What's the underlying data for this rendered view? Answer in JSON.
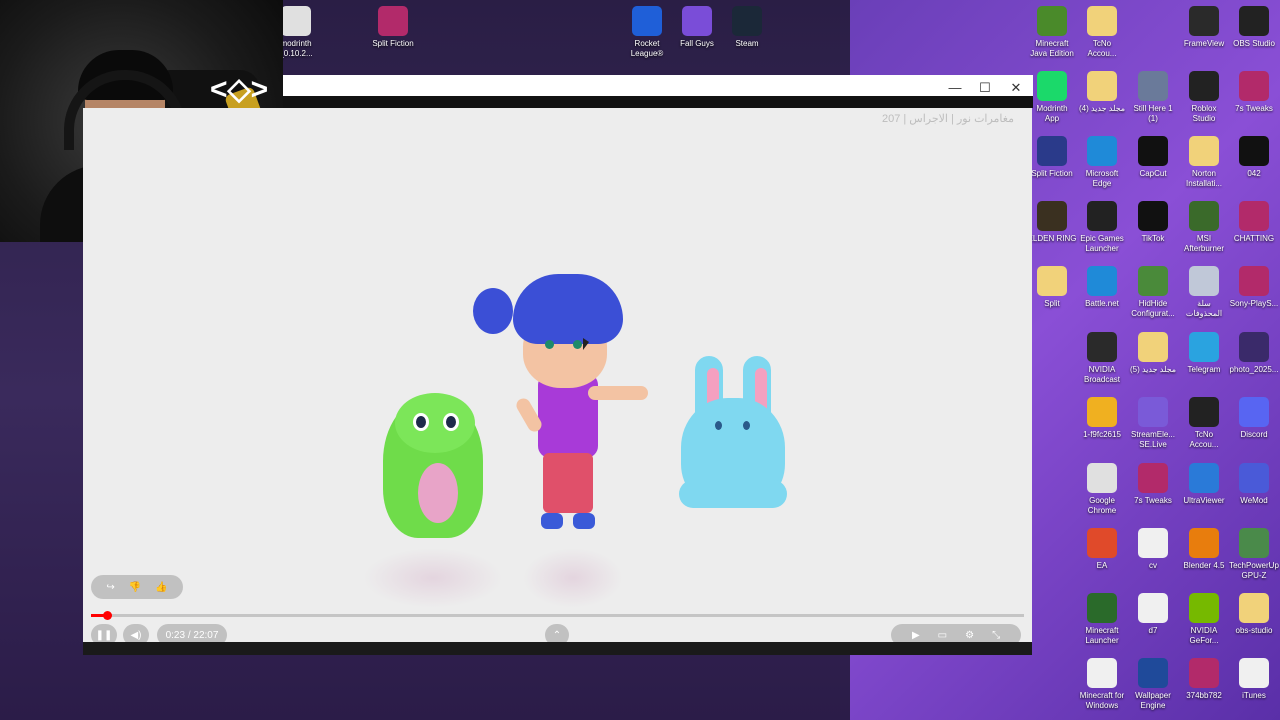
{
  "desktop": {
    "top_icons": [
      {
        "label": "modrinth\n_0.10.2...",
        "icon": "modrinth-installer-icon",
        "color": "#e0e0e0"
      },
      {
        "label": "Split Fiction",
        "icon": "winrar-icon",
        "color": "#b22a6a"
      },
      {
        "label": "Rocket\nLeague®",
        "icon": "rocket-league-icon",
        "color": "#1f5fd8"
      },
      {
        "label": "Fall Guys",
        "icon": "fall-guys-icon",
        "color": "#7a4dd8"
      },
      {
        "label": "Steam",
        "icon": "steam-icon",
        "color": "#1b2838"
      }
    ],
    "right_icons": [
      {
        "label": "Minecraft\nJava Edition",
        "icon": "minecraft-icon",
        "color": "#4a8a2a"
      },
      {
        "label": "TcNo\nAccou...",
        "icon": "folder-icon",
        "color": "#f1d27a"
      },
      {
        "label": "FrameView",
        "icon": "frameview-icon",
        "color": "#2a2a2a"
      },
      {
        "label": "OBS Studio",
        "icon": "obs-icon",
        "color": "#222222"
      },
      {
        "label": "Modrinth\nApp",
        "icon": "modrinth-icon",
        "color": "#1bd96a"
      },
      {
        "label": "مجلد جديد (4)",
        "icon": "folder-icon",
        "color": "#f1d27a"
      },
      {
        "label": "Still Here 1\n(1)",
        "icon": "image-icon",
        "color": "#6a7a9a"
      },
      {
        "label": "Roblox\nStudio",
        "icon": "roblox-studio-icon",
        "color": "#222222"
      },
      {
        "label": "7s Tweaks",
        "icon": "winrar-icon",
        "color": "#b22a6a"
      },
      {
        "label": "Split Fiction",
        "icon": "split-fiction-icon",
        "color": "#2a3a8a"
      },
      {
        "label": "Microsoft\nEdge",
        "icon": "edge-icon",
        "color": "#1f8ad8"
      },
      {
        "label": "CapCut",
        "icon": "capcut-icon",
        "color": "#111111"
      },
      {
        "label": "Norton\nInstallati...",
        "icon": "folder-icon",
        "color": "#f1d27a"
      },
      {
        "label": "042",
        "icon": "image-icon",
        "color": "#111111"
      },
      {
        "label": "ELDEN RING",
        "icon": "elden-ring-icon",
        "color": "#3a3020"
      },
      {
        "label": "Epic Games\nLauncher",
        "icon": "epic-games-icon",
        "color": "#222222"
      },
      {
        "label": "TikTok",
        "icon": "tiktok-icon",
        "color": "#111111"
      },
      {
        "label": "MSI\nAfterburner",
        "icon": "msi-afterburner-icon",
        "color": "#3a6a2a"
      },
      {
        "label": "CHATTING",
        "icon": "winrar-icon",
        "color": "#b22a6a"
      },
      {
        "label": "Split",
        "icon": "folder-icon",
        "color": "#f1d27a"
      },
      {
        "label": "Battle.net",
        "icon": "battlenet-icon",
        "color": "#1f8ad8"
      },
      {
        "label": "HidHide\nConfigurat...",
        "icon": "hidhide-icon",
        "color": "#4a8a3a"
      },
      {
        "label": "سلة\nالمحذوفات",
        "icon": "recycle-bin-icon",
        "color": "#c0c8d8"
      },
      {
        "label": "Sony-PlayS...",
        "icon": "winrar-icon",
        "color": "#b22a6a"
      },
      {
        "label": "NVIDIA\nBroadcast",
        "icon": "nvidia-broadcast-icon",
        "color": "#2a2a2a"
      },
      {
        "label": "مجلد جديد (5)",
        "icon": "folder-icon",
        "color": "#f1d27a"
      },
      {
        "label": "Telegram",
        "icon": "telegram-icon",
        "color": "#2aa3e0"
      },
      {
        "label": "photo_2025...",
        "icon": "image-icon",
        "color": "#3a2a6a"
      },
      {
        "label": "1-f9fc2615",
        "icon": "emoji-icon",
        "color": "#f0b020"
      },
      {
        "label": "StreamEle...\nSE.Live",
        "icon": "streamelements-icon",
        "color": "#7a5ad8"
      },
      {
        "label": "TcNo\nAccou...",
        "icon": "tcno-icon",
        "color": "#222222"
      },
      {
        "label": "Discord",
        "icon": "discord-icon",
        "color": "#5865f2"
      },
      {
        "label": "Google\nChrome",
        "icon": "chrome-icon",
        "color": "#e0e0e0"
      },
      {
        "label": "7s Tweaks",
        "icon": "winrar-icon",
        "color": "#b22a6a"
      },
      {
        "label": "UltraViewer",
        "icon": "ultraviewer-icon",
        "color": "#2a7ad8"
      },
      {
        "label": "WeMod",
        "icon": "wemod-icon",
        "color": "#4a5ad8"
      },
      {
        "label": "EA",
        "icon": "ea-icon",
        "color": "#e04a2a"
      },
      {
        "label": "cv",
        "icon": "document-icon",
        "color": "#f0f0f0"
      },
      {
        "label": "Blender 4.5",
        "icon": "blender-icon",
        "color": "#e87d0d"
      },
      {
        "label": "TechPowerUp\nGPU-Z",
        "icon": "gpuz-icon",
        "color": "#4a8a4a"
      },
      {
        "label": "Minecraft\nLauncher",
        "icon": "minecraft-launcher-icon",
        "color": "#2a6a2a"
      },
      {
        "label": "d7",
        "icon": "document-icon",
        "color": "#f0f0f0"
      },
      {
        "label": "NVIDIA\nGeFor...",
        "icon": "nvidia-icon",
        "color": "#76b900"
      },
      {
        "label": "obs-studio",
        "icon": "folder-icon",
        "color": "#f1d27a"
      },
      {
        "label": "Minecraft for\nWindows",
        "icon": "document-icon",
        "color": "#f0f0f0"
      },
      {
        "label": "Wallpaper\nEngine",
        "icon": "wallpaper-engine-icon",
        "color": "#1f4a9a"
      },
      {
        "label": "374bb782",
        "icon": "winrar-icon",
        "color": "#b22a6a"
      },
      {
        "label": "iTunes",
        "icon": "itunes-icon",
        "color": "#f0f0f0"
      }
    ]
  },
  "window": {
    "minimize": "—",
    "maximize": "☐",
    "close": "✕"
  },
  "video": {
    "title": "مغامرات نور | الاجراس | 207",
    "current_time": "0:23",
    "duration": "22:07",
    "time_separator": " / ",
    "progress": 0.017,
    "accent_color": "#ff0000"
  }
}
